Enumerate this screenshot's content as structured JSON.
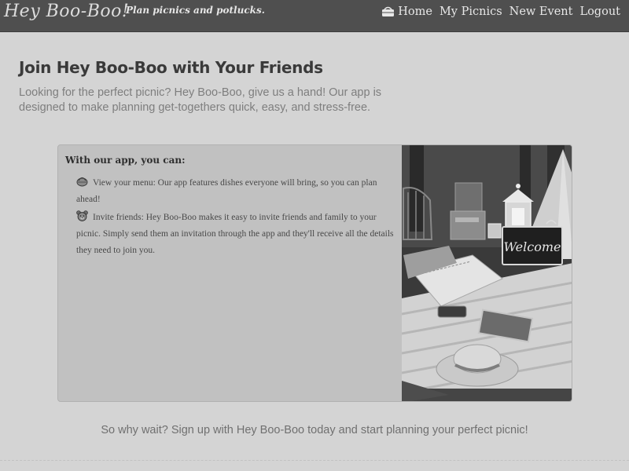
{
  "navbar": {
    "brand": "Hey Boo-Boo!",
    "tagline": "Plan picnics and potlucks.",
    "links": [
      {
        "label": "Home",
        "icon": "picnic-basket-icon"
      },
      {
        "label": "My Picnics"
      },
      {
        "label": "New Event"
      },
      {
        "label": "Logout"
      }
    ]
  },
  "hero": {
    "title": "Join Hey Boo-Boo with Your Friends",
    "subtitle": "Looking for the perfect picnic? Hey Boo-Boo, give us a hand! Our app is designed to make planning get-togethers quick, easy, and stress-free."
  },
  "card": {
    "heading": "With our app, you can:",
    "features": [
      {
        "icon": "basket-icon",
        "text": "View your menu: Our app features dishes everyone will bring, so you can plan ahead!"
      },
      {
        "icon": "bear-icon",
        "text": "Invite friends: Hey Boo-Boo makes it easy to invite friends and family to your picnic. Simply send them an invitation through the app and they'll receive all the details they need to join you."
      }
    ],
    "photo": {
      "sign_text": "Welcome"
    }
  },
  "cta": {
    "text": "So why wait? Sign up with Hey Boo-Boo today and start planning your perfect picnic!"
  }
}
